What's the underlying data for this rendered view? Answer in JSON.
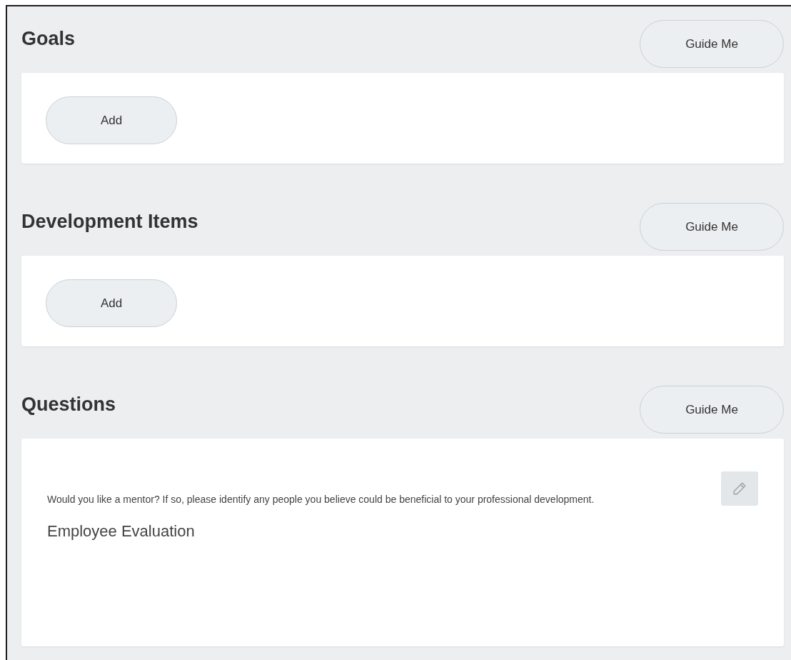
{
  "sections": [
    {
      "title": "Goals",
      "guide_button": "Guide Me",
      "kind": "add",
      "add_button": "Add"
    },
    {
      "title": "Development Items",
      "guide_button": "Guide Me",
      "kind": "add",
      "add_button": "Add"
    },
    {
      "title": "Questions",
      "guide_button": "Guide Me",
      "kind": "question",
      "question": "Would you like a mentor? If so, please identify any people you believe could be beneficial to your professional development.",
      "answer": "Employee Evaluation"
    }
  ]
}
